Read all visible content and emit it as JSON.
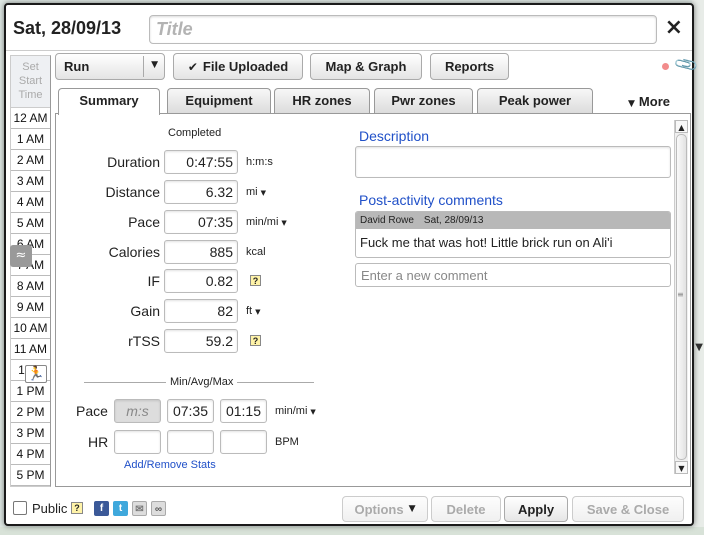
{
  "header": {
    "date": "Sat, 28/09/13",
    "title_placeholder": "Title",
    "close": "×"
  },
  "time_column": {
    "header": [
      "Set",
      "Start",
      "Time"
    ],
    "times": [
      "12 AM",
      "1 AM",
      "2 AM",
      "3 AM",
      "4 AM",
      "5 AM",
      "6 AM",
      "7 AM",
      "8 AM",
      "9 AM",
      "10 AM",
      "11 AM",
      "12 P",
      "1 PM",
      "2 PM",
      "3 PM",
      "4 PM",
      "5 PM"
    ]
  },
  "toolbar": {
    "sport_select": "Run",
    "file_uploaded": "File Uploaded",
    "map_graph": "Map & Graph",
    "reports": "Reports"
  },
  "tabs": [
    "Summary",
    "Equipment",
    "HR zones",
    "Pwr zones",
    "Peak power"
  ],
  "more": "More",
  "summary": {
    "status": "Completed",
    "fields": [
      {
        "label": "Duration",
        "value": "0:47:55",
        "unit": "h:m:s",
        "dropdown": false,
        "help": false
      },
      {
        "label": "Distance",
        "value": "6.32",
        "unit": "mi",
        "dropdown": true,
        "help": false
      },
      {
        "label": "Pace",
        "value": "07:35",
        "unit": "min/mi",
        "dropdown": true,
        "help": false
      },
      {
        "label": "Calories",
        "value": "885",
        "unit": "kcal",
        "dropdown": false,
        "help": false
      },
      {
        "label": "IF",
        "value": "0.82",
        "unit": "",
        "dropdown": false,
        "help": true
      },
      {
        "label": "Gain",
        "value": "82",
        "unit": "ft",
        "dropdown": true,
        "help": false
      },
      {
        "label": "rTSS",
        "value": "59.2",
        "unit": "",
        "dropdown": false,
        "help": true
      }
    ],
    "min_avg_max": {
      "heading": "Min/Avg/Max",
      "pace": {
        "label": "Pace",
        "min_placeholder": "m:s",
        "avg": "07:35",
        "max": "01:15",
        "unit": "min/mi"
      },
      "hr": {
        "label": "HR",
        "min": "",
        "avg": "",
        "max": "",
        "unit": "BPM"
      }
    },
    "add_remove_stats": "Add/Remove Stats",
    "help_glyph": "?"
  },
  "description": {
    "label": "Description",
    "value": ""
  },
  "comments": {
    "label": "Post-activity comments",
    "items": [
      {
        "author": "David Rowe",
        "date": "Sat, 28/09/13",
        "text": "Fuck me that was hot! Little brick run on Ali'i"
      }
    ],
    "new_placeholder": "Enter a new comment"
  },
  "footer": {
    "public_label": "Public",
    "help_glyph": "?",
    "options": "Options",
    "delete": "Delete",
    "apply": "Apply",
    "save_close": "Save & Close"
  },
  "colors": {
    "link_blue": "#2050c8",
    "help_yellow": "#fff3a8",
    "facebook": "#3b5998",
    "twitter": "#3fa8dc"
  }
}
